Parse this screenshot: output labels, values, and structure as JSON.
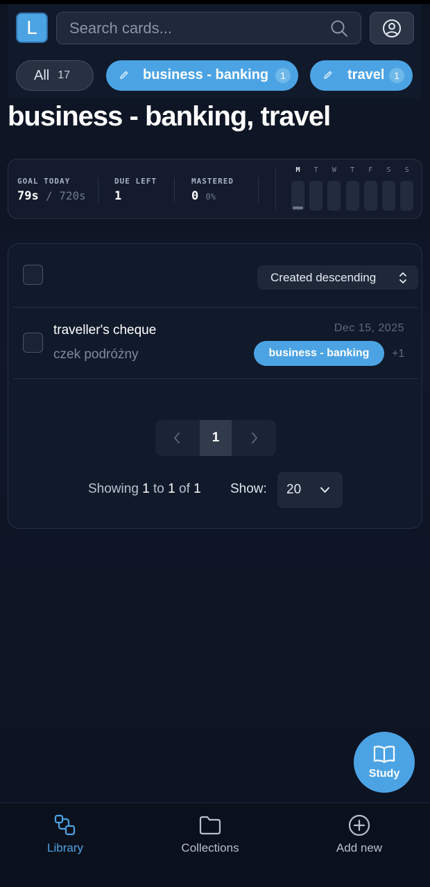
{
  "header": {
    "logo_letter": "L",
    "search_placeholder": "Search cards...",
    "chips": {
      "all": {
        "label": "All",
        "count": "17"
      },
      "tag1": {
        "label": "business - banking",
        "count": "1"
      },
      "tag2": {
        "label": "travel",
        "count": "1"
      }
    }
  },
  "page_title": "business - banking, travel",
  "stats": {
    "goal_label": "GOAL TODAY",
    "goal_value": "79s",
    "goal_total": "/ 720s",
    "due_label": "DUE LEFT",
    "due_value": "1",
    "mastered_label": "MASTERED",
    "mastered_value": "0",
    "mastered_pct": "0%",
    "days": [
      {
        "label": "M",
        "active": true,
        "progress": 0.11
      },
      {
        "label": "T",
        "active": false,
        "progress": 0
      },
      {
        "label": "W",
        "active": false,
        "progress": 0
      },
      {
        "label": "T",
        "active": false,
        "progress": 0
      },
      {
        "label": "F",
        "active": false,
        "progress": 0
      },
      {
        "label": "S",
        "active": false,
        "progress": 0
      },
      {
        "label": "S",
        "active": false,
        "progress": 0
      }
    ]
  },
  "list": {
    "sort_label": "Created descending",
    "cards": [
      {
        "front": "traveller's cheque",
        "back": "czek podróżny",
        "date": "Dec 15, 2025",
        "tag": "business - banking",
        "more_tags": "+1"
      }
    ],
    "pagination": {
      "current_page": "1",
      "showing_prefix": "Showing",
      "from": "1",
      "to_word": "to",
      "to": "1",
      "of_word": "of",
      "total": "1",
      "show_label": "Show:",
      "per_page": "20"
    }
  },
  "fab_label": "Study",
  "nav": {
    "library": "Library",
    "collections": "Collections",
    "add_new": "Add new"
  },
  "colors": {
    "accent": "#4ca3e4",
    "background": "#0f1729",
    "panel": "#111a2a"
  }
}
